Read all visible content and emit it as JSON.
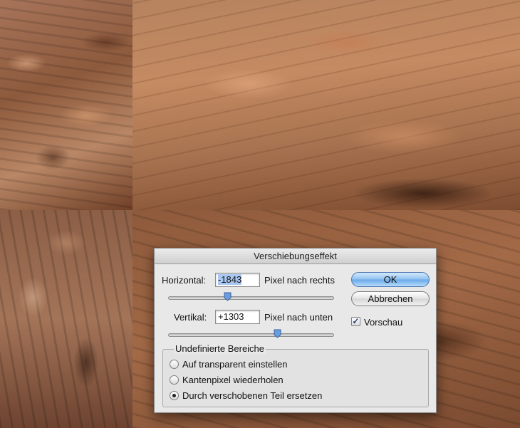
{
  "dialog": {
    "title": "Verschiebungseffekt",
    "horizontal": {
      "label": "Horizontal:",
      "value": "-1843",
      "unit": "Pixel nach rechts",
      "slider_position": 0.36
    },
    "vertikal": {
      "label": "Vertikal:",
      "value": "+1303",
      "unit": "Pixel nach unten",
      "slider_position": 0.66
    },
    "ok_label": "OK",
    "cancel_label": "Abbrechen",
    "preview": {
      "label": "Vorschau",
      "checked": true,
      "check_glyph": "✓"
    },
    "undefined_areas": {
      "legend": "Undefinierte Bereiche",
      "options": [
        {
          "label": "Auf transparent einstellen",
          "selected": false
        },
        {
          "label": "Kantenpixel wiederholen",
          "selected": false
        },
        {
          "label": "Durch verschobenen Teil ersetzen",
          "selected": true
        }
      ]
    }
  },
  "colors": {
    "default_button": "#69a8e8",
    "selection_highlight": "#a9c8f2",
    "dialog_background": "#e8e8e8"
  },
  "icons": {
    "slider_thumb": "slider-thumb-icon",
    "checkmark": "checkmark-icon"
  }
}
